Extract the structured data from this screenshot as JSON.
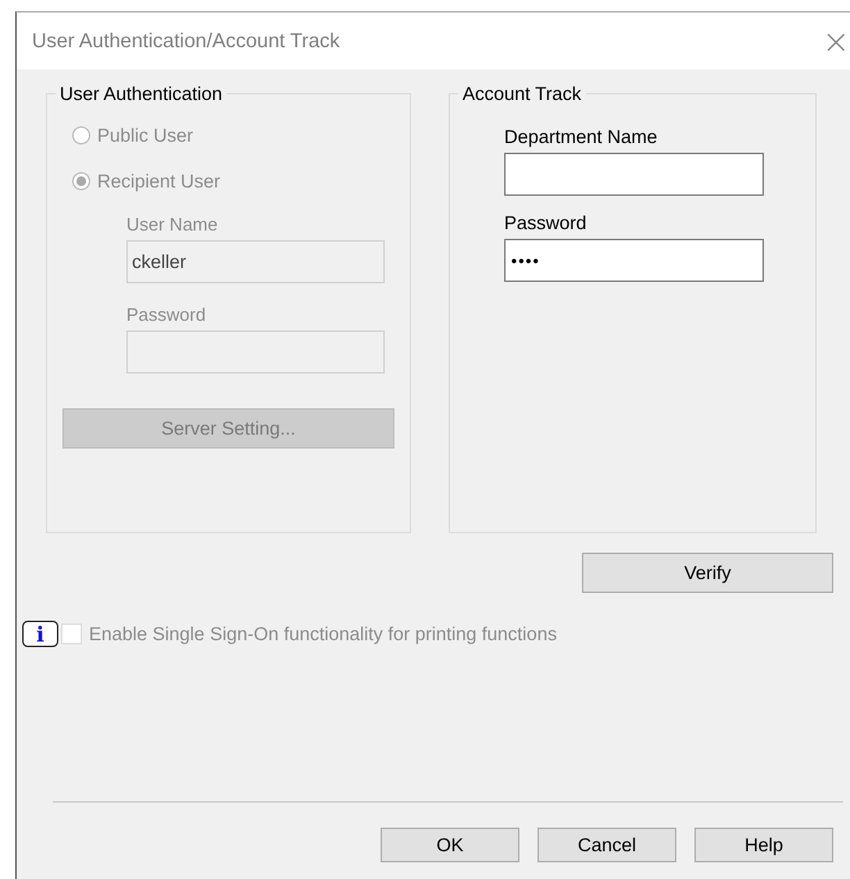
{
  "window": {
    "title": "User Authentication/Account Track",
    "close": "×"
  },
  "user_authentication": {
    "title": "User Authentication",
    "disabled": true,
    "radios": [
      {
        "label": "Public User",
        "selected": false
      },
      {
        "label": "Recipient User",
        "selected": true
      }
    ],
    "user_name": {
      "label": "User Name",
      "value": "ckeller"
    },
    "password": {
      "label": "Password"
    },
    "server_button": "Server Setting..."
  },
  "account_track": {
    "title": "Account Track",
    "department_name": {
      "label": "Department Name"
    },
    "password": {
      "label": "Password",
      "value": "••••"
    }
  },
  "verify_button": "Verify",
  "info_icon": "i",
  "single_sign_on": {
    "label": "Enable Single Sign-On functionality for printing functions",
    "checked": false,
    "disabled": true
  },
  "buttons": [
    "OK",
    "Cancel",
    "Help"
  ]
}
